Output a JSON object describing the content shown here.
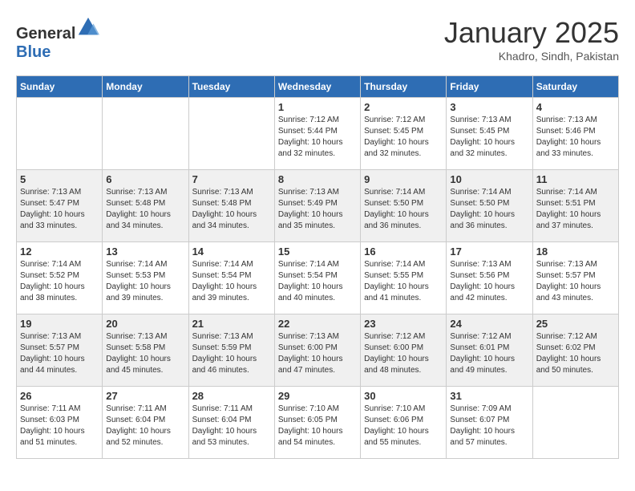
{
  "header": {
    "logo_general": "General",
    "logo_blue": "Blue",
    "month_title": "January 2025",
    "location": "Khadro, Sindh, Pakistan"
  },
  "days_of_week": [
    "Sunday",
    "Monday",
    "Tuesday",
    "Wednesday",
    "Thursday",
    "Friday",
    "Saturday"
  ],
  "weeks": [
    [
      {
        "day": "",
        "sunrise": "",
        "sunset": "",
        "daylight": ""
      },
      {
        "day": "",
        "sunrise": "",
        "sunset": "",
        "daylight": ""
      },
      {
        "day": "",
        "sunrise": "",
        "sunset": "",
        "daylight": ""
      },
      {
        "day": "1",
        "sunrise": "Sunrise: 7:12 AM",
        "sunset": "Sunset: 5:44 PM",
        "daylight": "Daylight: 10 hours and 32 minutes."
      },
      {
        "day": "2",
        "sunrise": "Sunrise: 7:12 AM",
        "sunset": "Sunset: 5:45 PM",
        "daylight": "Daylight: 10 hours and 32 minutes."
      },
      {
        "day": "3",
        "sunrise": "Sunrise: 7:13 AM",
        "sunset": "Sunset: 5:45 PM",
        "daylight": "Daylight: 10 hours and 32 minutes."
      },
      {
        "day": "4",
        "sunrise": "Sunrise: 7:13 AM",
        "sunset": "Sunset: 5:46 PM",
        "daylight": "Daylight: 10 hours and 33 minutes."
      }
    ],
    [
      {
        "day": "5",
        "sunrise": "Sunrise: 7:13 AM",
        "sunset": "Sunset: 5:47 PM",
        "daylight": "Daylight: 10 hours and 33 minutes."
      },
      {
        "day": "6",
        "sunrise": "Sunrise: 7:13 AM",
        "sunset": "Sunset: 5:48 PM",
        "daylight": "Daylight: 10 hours and 34 minutes."
      },
      {
        "day": "7",
        "sunrise": "Sunrise: 7:13 AM",
        "sunset": "Sunset: 5:48 PM",
        "daylight": "Daylight: 10 hours and 34 minutes."
      },
      {
        "day": "8",
        "sunrise": "Sunrise: 7:13 AM",
        "sunset": "Sunset: 5:49 PM",
        "daylight": "Daylight: 10 hours and 35 minutes."
      },
      {
        "day": "9",
        "sunrise": "Sunrise: 7:14 AM",
        "sunset": "Sunset: 5:50 PM",
        "daylight": "Daylight: 10 hours and 36 minutes."
      },
      {
        "day": "10",
        "sunrise": "Sunrise: 7:14 AM",
        "sunset": "Sunset: 5:50 PM",
        "daylight": "Daylight: 10 hours and 36 minutes."
      },
      {
        "day": "11",
        "sunrise": "Sunrise: 7:14 AM",
        "sunset": "Sunset: 5:51 PM",
        "daylight": "Daylight: 10 hours and 37 minutes."
      }
    ],
    [
      {
        "day": "12",
        "sunrise": "Sunrise: 7:14 AM",
        "sunset": "Sunset: 5:52 PM",
        "daylight": "Daylight: 10 hours and 38 minutes."
      },
      {
        "day": "13",
        "sunrise": "Sunrise: 7:14 AM",
        "sunset": "Sunset: 5:53 PM",
        "daylight": "Daylight: 10 hours and 39 minutes."
      },
      {
        "day": "14",
        "sunrise": "Sunrise: 7:14 AM",
        "sunset": "Sunset: 5:54 PM",
        "daylight": "Daylight: 10 hours and 39 minutes."
      },
      {
        "day": "15",
        "sunrise": "Sunrise: 7:14 AM",
        "sunset": "Sunset: 5:54 PM",
        "daylight": "Daylight: 10 hours and 40 minutes."
      },
      {
        "day": "16",
        "sunrise": "Sunrise: 7:14 AM",
        "sunset": "Sunset: 5:55 PM",
        "daylight": "Daylight: 10 hours and 41 minutes."
      },
      {
        "day": "17",
        "sunrise": "Sunrise: 7:13 AM",
        "sunset": "Sunset: 5:56 PM",
        "daylight": "Daylight: 10 hours and 42 minutes."
      },
      {
        "day": "18",
        "sunrise": "Sunrise: 7:13 AM",
        "sunset": "Sunset: 5:57 PM",
        "daylight": "Daylight: 10 hours and 43 minutes."
      }
    ],
    [
      {
        "day": "19",
        "sunrise": "Sunrise: 7:13 AM",
        "sunset": "Sunset: 5:57 PM",
        "daylight": "Daylight: 10 hours and 44 minutes."
      },
      {
        "day": "20",
        "sunrise": "Sunrise: 7:13 AM",
        "sunset": "Sunset: 5:58 PM",
        "daylight": "Daylight: 10 hours and 45 minutes."
      },
      {
        "day": "21",
        "sunrise": "Sunrise: 7:13 AM",
        "sunset": "Sunset: 5:59 PM",
        "daylight": "Daylight: 10 hours and 46 minutes."
      },
      {
        "day": "22",
        "sunrise": "Sunrise: 7:13 AM",
        "sunset": "Sunset: 6:00 PM",
        "daylight": "Daylight: 10 hours and 47 minutes."
      },
      {
        "day": "23",
        "sunrise": "Sunrise: 7:12 AM",
        "sunset": "Sunset: 6:00 PM",
        "daylight": "Daylight: 10 hours and 48 minutes."
      },
      {
        "day": "24",
        "sunrise": "Sunrise: 7:12 AM",
        "sunset": "Sunset: 6:01 PM",
        "daylight": "Daylight: 10 hours and 49 minutes."
      },
      {
        "day": "25",
        "sunrise": "Sunrise: 7:12 AM",
        "sunset": "Sunset: 6:02 PM",
        "daylight": "Daylight: 10 hours and 50 minutes."
      }
    ],
    [
      {
        "day": "26",
        "sunrise": "Sunrise: 7:11 AM",
        "sunset": "Sunset: 6:03 PM",
        "daylight": "Daylight: 10 hours and 51 minutes."
      },
      {
        "day": "27",
        "sunrise": "Sunrise: 7:11 AM",
        "sunset": "Sunset: 6:04 PM",
        "daylight": "Daylight: 10 hours and 52 minutes."
      },
      {
        "day": "28",
        "sunrise": "Sunrise: 7:11 AM",
        "sunset": "Sunset: 6:04 PM",
        "daylight": "Daylight: 10 hours and 53 minutes."
      },
      {
        "day": "29",
        "sunrise": "Sunrise: 7:10 AM",
        "sunset": "Sunset: 6:05 PM",
        "daylight": "Daylight: 10 hours and 54 minutes."
      },
      {
        "day": "30",
        "sunrise": "Sunrise: 7:10 AM",
        "sunset": "Sunset: 6:06 PM",
        "daylight": "Daylight: 10 hours and 55 minutes."
      },
      {
        "day": "31",
        "sunrise": "Sunrise: 7:09 AM",
        "sunset": "Sunset: 6:07 PM",
        "daylight": "Daylight: 10 hours and 57 minutes."
      },
      {
        "day": "",
        "sunrise": "",
        "sunset": "",
        "daylight": ""
      }
    ]
  ]
}
